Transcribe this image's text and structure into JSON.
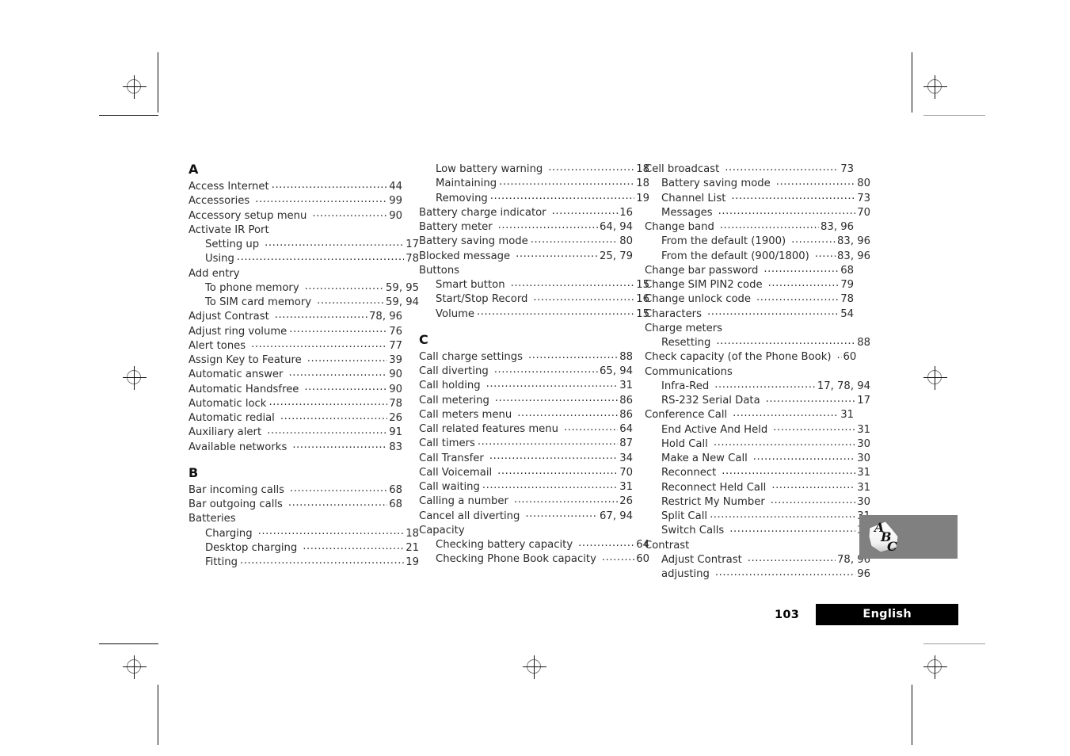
{
  "document": {
    "page_number": "103",
    "language_tab": "English",
    "thumb_tab_label": "ABC"
  },
  "index": {
    "columns": [
      {
        "id": "column-1",
        "blocks": [
          {
            "letter": "A",
            "entries": [
              {
                "label": "Access Internet",
                "pages": "44"
              },
              {
                "label": "Accessories",
                "pages": "99",
                "gap": true
              },
              {
                "label": "Accessory setup menu",
                "pages": "90",
                "gap": true
              },
              {
                "label": "Activate IR Port",
                "pages": ""
              },
              {
                "label": "Setting up",
                "pages": "17",
                "sub": true,
                "gap": true
              },
              {
                "label": "Using",
                "pages": "78",
                "sub": true
              },
              {
                "label": "Add entry",
                "pages": ""
              },
              {
                "label": "To phone memory",
                "pages": "59, 95",
                "sub": true,
                "gap": true
              },
              {
                "label": "To SIM card memory",
                "pages": "59, 94",
                "sub": true,
                "gap": true
              },
              {
                "label": "Adjust Contrast",
                "pages": "78, 96",
                "gap": true
              },
              {
                "label": "Adjust ring volume",
                "pages": "76"
              },
              {
                "label": "Alert tones",
                "pages": "77",
                "gap": true
              },
              {
                "label": "Assign Key to Feature",
                "pages": "39",
                "gap": true
              },
              {
                "label": "Automatic answer",
                "pages": "90",
                "gap": true
              },
              {
                "label": "Automatic Handsfree",
                "pages": "90",
                "gap": true
              },
              {
                "label": "Automatic lock",
                "pages": "78"
              },
              {
                "label": "Automatic redial",
                "pages": "26",
                "gap": true
              },
              {
                "label": "Auxiliary alert",
                "pages": "91",
                "gap": true
              },
              {
                "label": "Available networks",
                "pages": "83",
                "gap": true
              }
            ]
          },
          {
            "letter": "B",
            "entries": [
              {
                "label": "Bar incoming calls",
                "pages": "68",
                "gap": true
              },
              {
                "label": "Bar outgoing calls",
                "pages": "68",
                "gap": true
              },
              {
                "label": "Batteries",
                "pages": ""
              },
              {
                "label": "Charging",
                "pages": "18",
                "sub": true,
                "gap": true
              },
              {
                "label": "Desktop charging",
                "pages": "21",
                "sub": true,
                "gap": true
              },
              {
                "label": "Fitting",
                "pages": "19",
                "sub": true
              }
            ]
          }
        ]
      },
      {
        "id": "column-2",
        "blocks": [
          {
            "letter": "",
            "entries": [
              {
                "label": "Low battery warning",
                "pages": "18",
                "sub": true,
                "gap": true
              },
              {
                "label": "Maintaining",
                "pages": "18",
                "sub": true
              },
              {
                "label": "Removing",
                "pages": "19",
                "sub": true
              },
              {
                "label": "Battery charge indicator",
                "pages": "16",
                "gap": true
              },
              {
                "label": "Battery meter",
                "pages": "64, 94",
                "gap": true
              },
              {
                "label": "Battery saving mode",
                "pages": "80"
              },
              {
                "label": "Blocked message",
                "pages": "25, 79",
                "gap": true
              },
              {
                "label": "Buttons",
                "pages": ""
              },
              {
                "label": "Smart button",
                "pages": "15",
                "sub": true,
                "gap": true
              },
              {
                "label": "Start/Stop Record",
                "pages": "16",
                "sub": true,
                "gap": true
              },
              {
                "label": "Volume",
                "pages": "15",
                "sub": true
              }
            ]
          },
          {
            "letter": "C",
            "entries": [
              {
                "label": "Call charge settings",
                "pages": "88",
                "gap": true
              },
              {
                "label": "Call diverting",
                "pages": "65, 94",
                "gap": true
              },
              {
                "label": "Call holding",
                "pages": "31",
                "gap": true
              },
              {
                "label": "Call metering",
                "pages": "86",
                "gap": true
              },
              {
                "label": "Call meters menu",
                "pages": "86",
                "gap": true
              },
              {
                "label": "Call related features menu",
                "pages": "64",
                "gap": true
              },
              {
                "label": "Call timers",
                "pages": "87"
              },
              {
                "label": "Call Transfer",
                "pages": "34",
                "gap": true
              },
              {
                "label": "Call Voicemail",
                "pages": "70",
                "gap": true
              },
              {
                "label": "Call waiting",
                "pages": "31"
              },
              {
                "label": "Calling a number",
                "pages": "26",
                "gap": true
              },
              {
                "label": "Cancel all diverting",
                "pages": "67, 94",
                "gap": true
              },
              {
                "label": "Capacity",
                "pages": ""
              },
              {
                "label": "Checking battery capacity",
                "pages": "64",
                "sub": true,
                "gap": true
              },
              {
                "label": "Checking Phone Book capacity",
                "pages": "60",
                "sub": true,
                "gap": true
              }
            ]
          }
        ]
      },
      {
        "id": "column-3",
        "blocks": [
          {
            "letter": "",
            "entries": [
              {
                "label": "Cell broadcast",
                "pages": "73",
                "gap": true
              },
              {
                "label": "Battery saving mode",
                "pages": "80",
                "sub": true,
                "gap": true
              },
              {
                "label": "Channel List",
                "pages": "73",
                "sub": true,
                "gap": true
              },
              {
                "label": "Messages",
                "pages": "70",
                "sub": true,
                "gap": true
              },
              {
                "label": "Change band",
                "pages": "83, 96",
                "gap": true
              },
              {
                "label": "From the default (1900)",
                "pages": "83, 96",
                "sub": true,
                "gap": true
              },
              {
                "label": "From the default (900/1800)",
                "pages": "83, 96",
                "sub": true,
                "gap": true
              },
              {
                "label": "Change bar password",
                "pages": "68",
                "gap": true
              },
              {
                "label": "Change SIM PIN2 code",
                "pages": "79",
                "gap": true
              },
              {
                "label": "Change unlock code",
                "pages": "78",
                "gap": true
              },
              {
                "label": "Characters",
                "pages": "54",
                "gap": true
              },
              {
                "label": "Charge meters",
                "pages": ""
              },
              {
                "label": "Resetting",
                "pages": "88",
                "sub": true,
                "gap": true
              },
              {
                "label": "Check capacity (of the Phone Book)",
                "pages": "60",
                "gap": true
              },
              {
                "label": "Communications",
                "pages": ""
              },
              {
                "label": "Infra-Red",
                "pages": "17, 78, 94",
                "sub": true,
                "gap": true
              },
              {
                "label": "RS-232 Serial Data",
                "pages": "17",
                "sub": true,
                "gap": true
              },
              {
                "label": "Conference Call",
                "pages": "31",
                "gap": true
              },
              {
                "label": "End Active And Held",
                "pages": "31",
                "sub": true,
                "gap": true
              },
              {
                "label": "Hold Call",
                "pages": "30",
                "sub": true,
                "gap": true
              },
              {
                "label": "Make a New Call",
                "pages": "30",
                "sub": true,
                "gap": true
              },
              {
                "label": "Reconnect",
                "pages": "31",
                "sub": true,
                "gap": true
              },
              {
                "label": "Reconnect Held Call",
                "pages": "31",
                "sub": true,
                "gap": true
              },
              {
                "label": "Restrict My Number",
                "pages": "30",
                "sub": true,
                "gap": true
              },
              {
                "label": "Split Call",
                "pages": "31",
                "sub": true
              },
              {
                "label": "Switch Calls",
                "pages": "31",
                "sub": true,
                "gap": true
              },
              {
                "label": "Contrast",
                "pages": ""
              },
              {
                "label": "Adjust Contrast",
                "pages": "78, 96",
                "sub": true,
                "gap": true
              },
              {
                "label": "adjusting",
                "pages": "96",
                "sub": true,
                "gap": true
              }
            ]
          }
        ]
      }
    ]
  }
}
